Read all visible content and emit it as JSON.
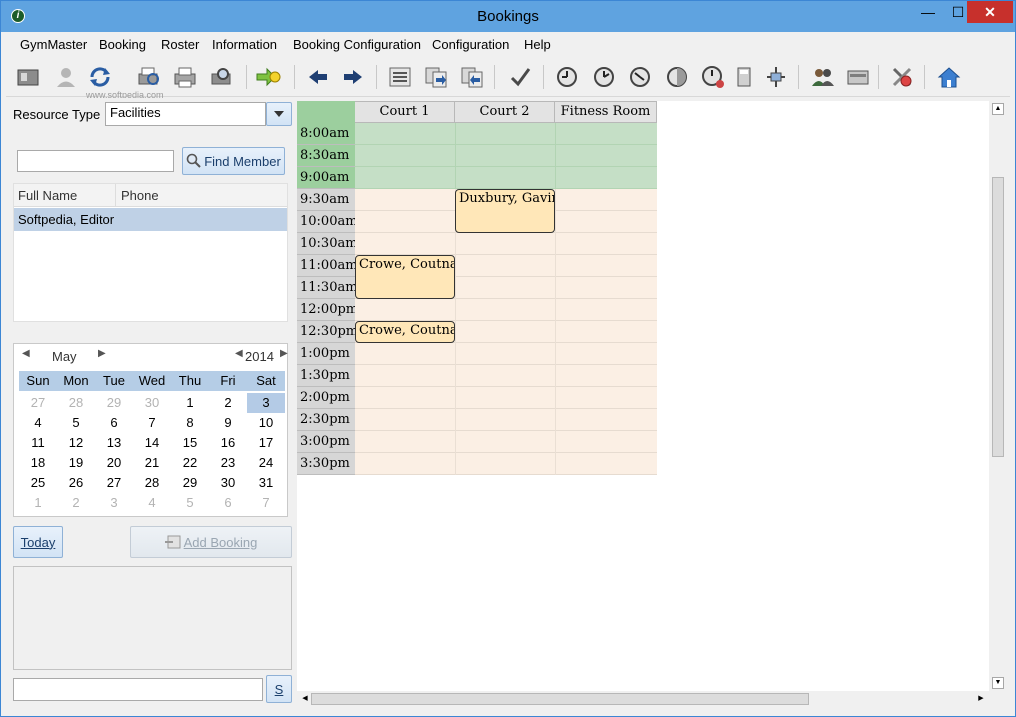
{
  "window": {
    "title": "Bookings",
    "app_icon": "gymmaster-logo",
    "min": "—",
    "max": "☐",
    "close": "✕"
  },
  "menu": [
    "GymMaster",
    "Booking",
    "Roster",
    "Information",
    "Booking Configuration",
    "Configuration",
    "Help"
  ],
  "watermark": "www.softpedia.com",
  "left": {
    "resource_type_label": "Resource Type",
    "resource_type_value": "Facilities",
    "search_value": "",
    "find_member": "Find Member",
    "grid_headers": [
      "Full Name",
      "Phone"
    ],
    "grid_rows": [
      {
        "name": "Softpedia, Editor",
        "phone": ""
      }
    ],
    "calendar": {
      "month": "May",
      "year": "2014",
      "day_headers": [
        "Sun",
        "Mon",
        "Tue",
        "Wed",
        "Thu",
        "Fri",
        "Sat"
      ],
      "weeks": [
        [
          "27",
          "28",
          "29",
          "30",
          "1",
          "2",
          "3"
        ],
        [
          "4",
          "5",
          "6",
          "7",
          "8",
          "9",
          "10"
        ],
        [
          "11",
          "12",
          "13",
          "14",
          "15",
          "16",
          "17"
        ],
        [
          "18",
          "19",
          "20",
          "21",
          "22",
          "23",
          "24"
        ],
        [
          "25",
          "26",
          "27",
          "28",
          "29",
          "30",
          "31"
        ],
        [
          "1",
          "2",
          "3",
          "4",
          "5",
          "6",
          "7"
        ]
      ]
    },
    "today": "Today",
    "add_booking": "Add Booking",
    "s_button": "S"
  },
  "schedule": {
    "columns": [
      "Court 1",
      "Court 2",
      "Fitness Room"
    ],
    "times": [
      "8:00am",
      "8:30am",
      "9:00am",
      "9:30am",
      "10:00am",
      "10:30am",
      "11:00am",
      "11:30am",
      "12:00pm",
      "12:30pm",
      "1:00pm",
      "1:30pm",
      "2:00pm",
      "2:30pm",
      "3:00pm",
      "3:30pm"
    ],
    "bookings": [
      {
        "name": "Duxbury, Gavin",
        "column": 1,
        "start": 3,
        "span": 2
      },
      {
        "name": "Crowe, Coutnay",
        "column": 0,
        "start": 6,
        "span": 2
      },
      {
        "name": "Crowe, Coutnay",
        "column": 0,
        "start": 9,
        "span": 1
      }
    ],
    "colors": {
      "closed": "#c5dfc6",
      "closed_time": "#9ccf9e",
      "open": "#fbefe4",
      "time_bg": "#d6d6d6"
    }
  }
}
